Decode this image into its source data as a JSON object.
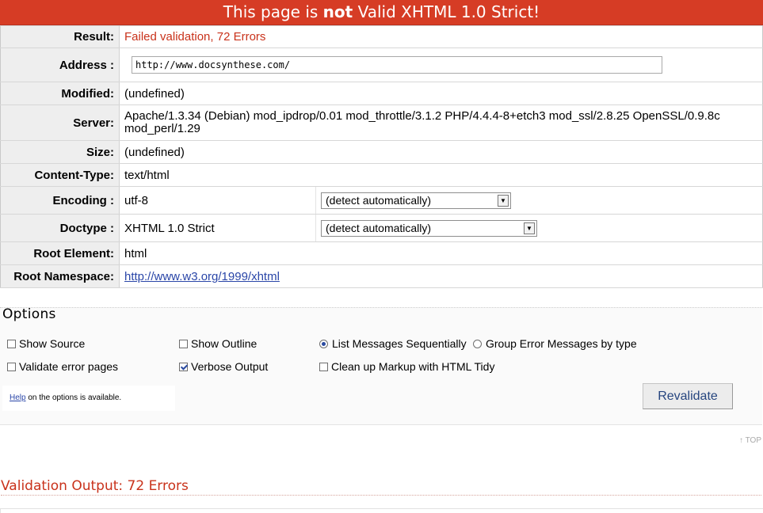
{
  "banner": {
    "prefix": "This page is ",
    "emphasis": "not",
    "suffix": " Valid XHTML 1.0 Strict!"
  },
  "meta": {
    "result_label": "Result:",
    "result_value": "Failed validation, 72 Errors",
    "address_label": "Address :",
    "address_value": "http://www.docsynthese.com/",
    "modified_label": "Modified:",
    "modified_value": "(undefined)",
    "server_label": "Server:",
    "server_value": "Apache/1.3.34 (Debian) mod_ipdrop/0.01 mod_throttle/3.1.2 PHP/4.4.4-8+etch3 mod_ssl/2.8.25 OpenSSL/0.9.8c mod_perl/1.29",
    "size_label": "Size:",
    "size_value": "(undefined)",
    "content_type_label": "Content-Type:",
    "content_type_value": "text/html",
    "encoding_label": "Encoding :",
    "encoding_value": "utf-8",
    "encoding_select": "(detect automatically)",
    "doctype_label": "Doctype :",
    "doctype_value": "XHTML 1.0 Strict",
    "doctype_select": "(detect automatically)",
    "root_element_label": "Root Element:",
    "root_element_value": "html",
    "root_namespace_label": "Root Namespace:",
    "root_namespace_value": "http://www.w3.org/1999/xhtml"
  },
  "options": {
    "title": "Options",
    "show_source": "Show Source",
    "show_outline": "Show Outline",
    "list_sequential": "List Messages Sequentially",
    "group_by_type": "Group Error Messages by type",
    "validate_error_pages": "Validate error pages",
    "verbose_output": "Verbose Output",
    "html_tidy": "Clean up Markup with HTML Tidy",
    "help_link": "Help",
    "help_text": " on the options is available.",
    "revalidate_label": "Revalidate"
  },
  "top_link": "↑ TOP",
  "output_title": "Validation Output: 72 Errors",
  "colors": {
    "banner_bg": "#d63c25",
    "error_text": "#c9321b",
    "link": "#2a46a8"
  }
}
